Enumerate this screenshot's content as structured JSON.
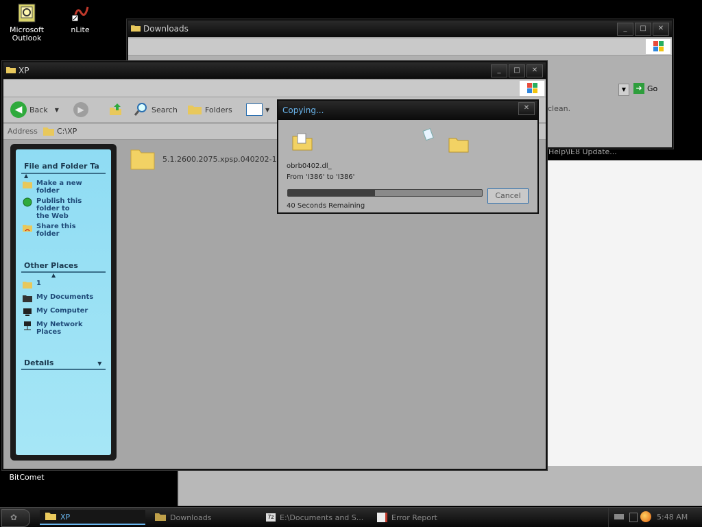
{
  "desktop": {
    "icons": [
      {
        "label": "Microsoft Outlook"
      },
      {
        "label": "nLite"
      },
      {
        "label": "BitComet"
      }
    ]
  },
  "downloads_window": {
    "title": "Downloads",
    "go_label": "Go",
    "clean_text": "clean.",
    "side_text": "Help\\IE8 Update..."
  },
  "xp_window": {
    "title": "XP",
    "toolbar": {
      "back": "Back",
      "search": "Search",
      "folders": "Folders"
    },
    "address_label": "Address",
    "address_value": "C:\\XP",
    "file_name": "5.1.2600.2075.xpsp.040202-19",
    "tasks": {
      "header": "File and Folder Ta",
      "items": [
        "Make a new folder",
        "Publish this folder to the Web",
        "Share this folder"
      ]
    },
    "other_places": {
      "header": "Other Places",
      "items": [
        "1",
        "My Documents",
        "My Computer",
        "My Network Places"
      ]
    },
    "details": {
      "header": "Details"
    }
  },
  "copy_dialog": {
    "title": "Copying...",
    "filename": "obrb0402.dl_",
    "from_to": "From 'I386' to 'I386'",
    "progress_fraction": 0.45,
    "remaining": "40 Seconds Remaining",
    "cancel": "Cancel"
  },
  "taskbar": {
    "tasks": [
      {
        "label": "XP",
        "active": true
      },
      {
        "label": "Downloads"
      },
      {
        "label": "E:\\Documents and S..."
      },
      {
        "label": "Error Report"
      }
    ],
    "clock": "5:48 AM"
  },
  "colors": {
    "accent_progress": "#3f3f3f",
    "side_panel": "#9ee2f5",
    "window_body": "#a6a6a6"
  }
}
